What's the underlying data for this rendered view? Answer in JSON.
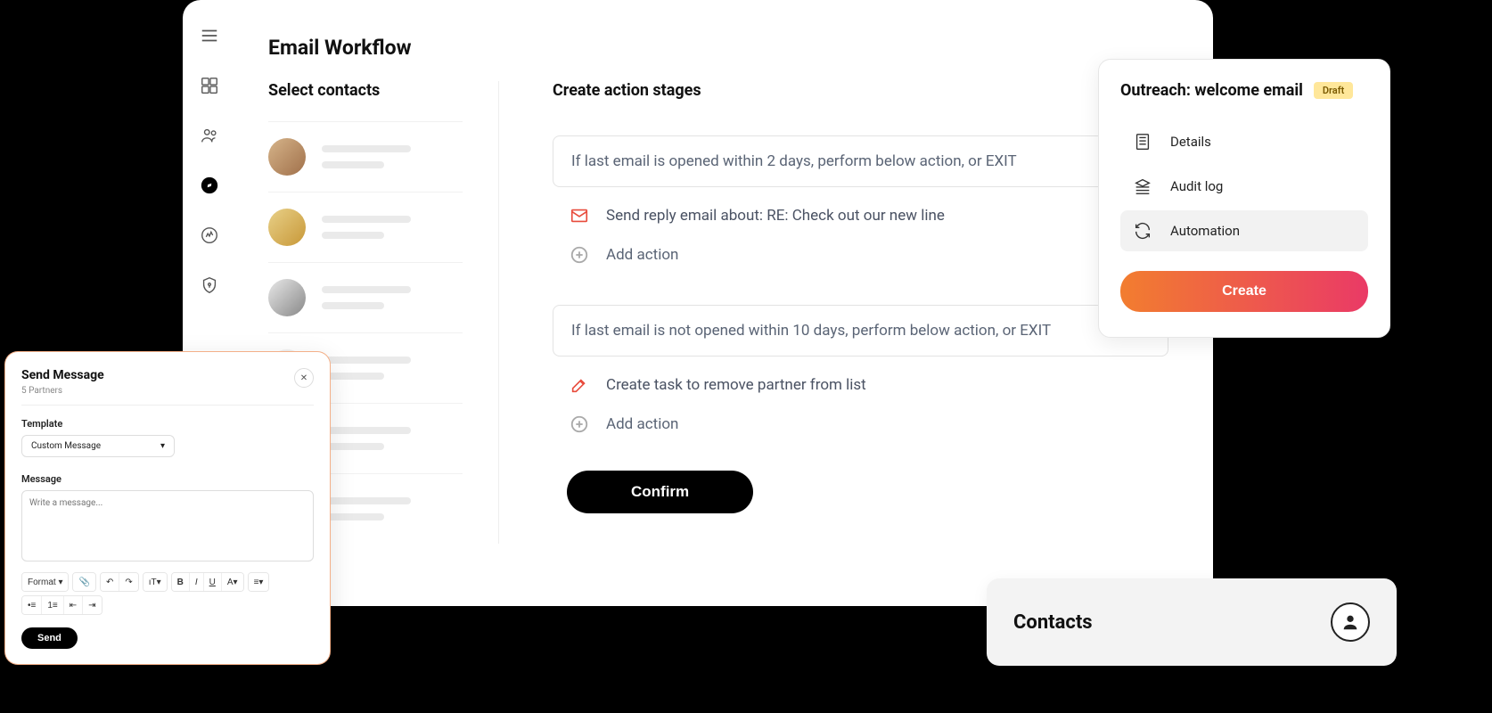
{
  "app": {
    "page_title": "Email Workflow",
    "select_contacts_title": "Select contacts",
    "create_stages_title": "Create action stages"
  },
  "stages": {
    "condition1": "If last email is opened within 2 days, perform below action, or EXIT",
    "action1": "Send reply email about: RE: Check out our new line",
    "add_action": "Add action",
    "condition2": "If last email is not opened within 10 days, perform below action, or EXIT",
    "action2": "Create task to remove partner from list",
    "confirm": "Confirm"
  },
  "send_message": {
    "title": "Send Message",
    "subtitle": "5 Partners",
    "template_label": "Template",
    "template_value": "Custom Message",
    "message_label": "Message",
    "message_placeholder": "Write a message...",
    "format_label": "Format",
    "send": "Send"
  },
  "outreach": {
    "title": "Outreach: welcome email",
    "badge": "Draft",
    "details": "Details",
    "audit_log": "Audit log",
    "automation": "Automation",
    "create": "Create"
  },
  "contacts_bar": {
    "title": "Contacts"
  }
}
